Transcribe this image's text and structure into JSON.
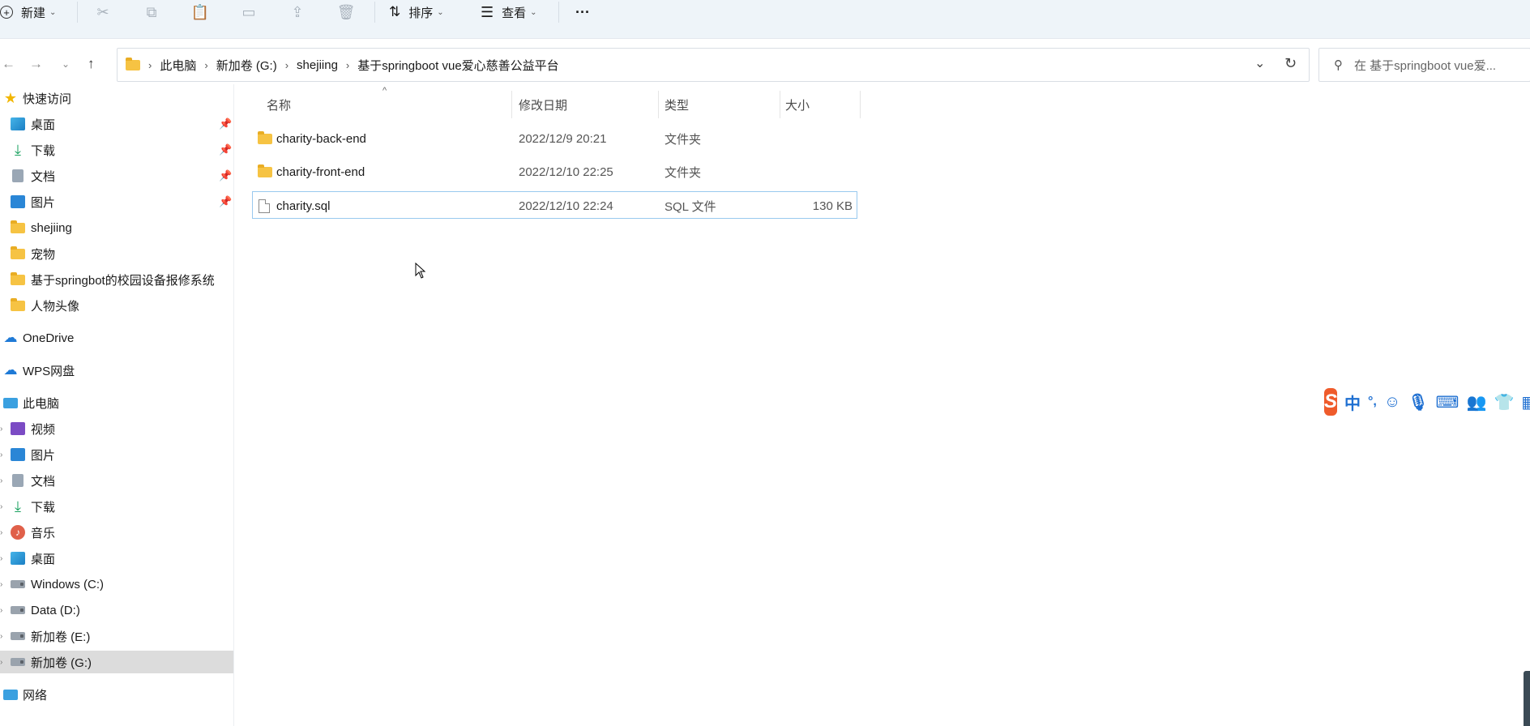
{
  "toolbar": {
    "new_label": "新建",
    "sort_label": "排序",
    "view_label": "查看",
    "more_label": "···"
  },
  "address": {
    "breadcrumbs": [
      "此电脑",
      "新加卷 (G:)",
      "shejiing",
      "基于springboot vue爱心慈善公益平台"
    ]
  },
  "search": {
    "placeholder": "在 基于springboot vue爱..."
  },
  "sidebar": {
    "quick_access": "快速访问",
    "quick_items": [
      {
        "label": "桌面"
      },
      {
        "label": "下载"
      },
      {
        "label": "文档"
      },
      {
        "label": "图片"
      },
      {
        "label": "shejiing"
      },
      {
        "label": "宠物"
      },
      {
        "label": "基于springbot的校园设备报修系统"
      },
      {
        "label": "人物头像"
      }
    ],
    "onedrive": "OneDrive",
    "wps": "WPS网盘",
    "this_pc": "此电脑",
    "pc_items": [
      {
        "label": "视频"
      },
      {
        "label": "图片"
      },
      {
        "label": "文档"
      },
      {
        "label": "下载"
      },
      {
        "label": "音乐"
      },
      {
        "label": "桌面"
      },
      {
        "label": "Windows (C:)"
      },
      {
        "label": "Data (D:)"
      },
      {
        "label": "新加卷 (E:)"
      },
      {
        "label": "新加卷 (G:)"
      }
    ],
    "network": "网络"
  },
  "columns": {
    "name": "名称",
    "date": "修改日期",
    "type": "类型",
    "size": "大小"
  },
  "files": [
    {
      "name": "charity-back-end",
      "date": "2022/12/9 20:21",
      "type": "文件夹",
      "size": ""
    },
    {
      "name": "charity-front-end",
      "date": "2022/12/10 22:25",
      "type": "文件夹",
      "size": ""
    },
    {
      "name": "charity.sql",
      "date": "2022/12/10 22:24",
      "type": "SQL 文件",
      "size": "130 KB"
    }
  ],
  "ime": {
    "logo": "S",
    "mode": "中",
    "punct": "°,"
  },
  "colors": {
    "accent": "#1e6fd1",
    "selection_border": "#99c9ef",
    "toolbar_bg": "#eef4f9",
    "ime_logo": "#ef5b2b"
  }
}
